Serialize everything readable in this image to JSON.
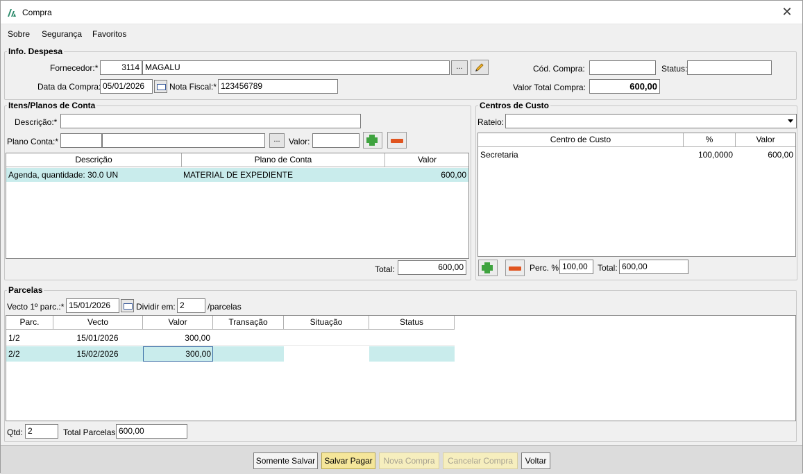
{
  "window": {
    "title": "Compra",
    "close_icon": "close-icon"
  },
  "menu": {
    "sobre": "Sobre",
    "seguranca": "Segurança",
    "favoritos": "Favoritos"
  },
  "info": {
    "group_label": "Info. Despesa",
    "fornecedor_label": "Fornecedor:*",
    "fornecedor_code": "3114",
    "fornecedor_name": "MAGALU",
    "browse": "...",
    "data_label": "Data da Compra:*",
    "data_value": "05/01/2026",
    "nota_label": "Nota Fiscal:*",
    "nota_value": "123456789",
    "cod_label": "Cód. Compra:",
    "cod_value": "",
    "status_label": "Status:",
    "status_value": "",
    "valor_total_label": "Valor Total Compra:",
    "valor_total_value": "600,00"
  },
  "itens": {
    "group_label": "Itens/Planos de Conta",
    "descricao_label": "Descrição:*",
    "descricao_value": "",
    "plano_label": "Plano Conta:*",
    "plano_code": "",
    "plano_name": "",
    "browse": "...",
    "valor_label": "Valor:",
    "valor_value": "",
    "columns": [
      "Descrição",
      "Plano de Conta",
      "Valor"
    ],
    "rows": [
      {
        "descricao": "Agenda, quantidade: 30.0 UN",
        "plano": "MATERIAL DE EXPEDIENTE",
        "valor": "600,00"
      }
    ],
    "total_label": "Total:",
    "total_value": "600,00"
  },
  "centros": {
    "group_label": "Centros de Custo",
    "rateio_label": "Rateio:",
    "rateio_value": "",
    "columns": [
      "Centro de Custo",
      "%",
      "Valor"
    ],
    "rows": [
      {
        "centro": "Secretaria",
        "perc": "100,0000",
        "valor": "600,00"
      }
    ],
    "perc_label": "Perc. %:",
    "perc_value": "100,00",
    "total_label": "Total:",
    "total_value": "600,00"
  },
  "parcelas": {
    "group_label": "Parcelas",
    "vecto_label": "Vecto 1º parc.:*",
    "vecto_value": "15/01/2026",
    "dividir_label": "Dividir em:",
    "dividir_value": "2",
    "parcelas_suffix": "/parcelas",
    "columns": [
      "Parc.",
      "Vecto",
      "Valor",
      "Transação",
      "Situação",
      "Status"
    ],
    "rows": [
      {
        "parc": "1/2",
        "vecto": "15/01/2026",
        "valor": "300,00",
        "transacao": "",
        "situacao": "",
        "status": ""
      },
      {
        "parc": "2/2",
        "vecto": "15/02/2026",
        "valor": "300,00",
        "transacao": "",
        "situacao": "",
        "status": ""
      }
    ],
    "qtd_label": "Qtd:",
    "qtd_value": "2",
    "total_label": "Total Parcelas:",
    "total_value": "600,00"
  },
  "footer": {
    "somente_salvar": "Somente Salvar",
    "salvar_pagar": "Salvar Pagar",
    "nova_compra": "Nova Compra",
    "cancelar_compra": "Cancelar Compra",
    "voltar": "Voltar"
  }
}
